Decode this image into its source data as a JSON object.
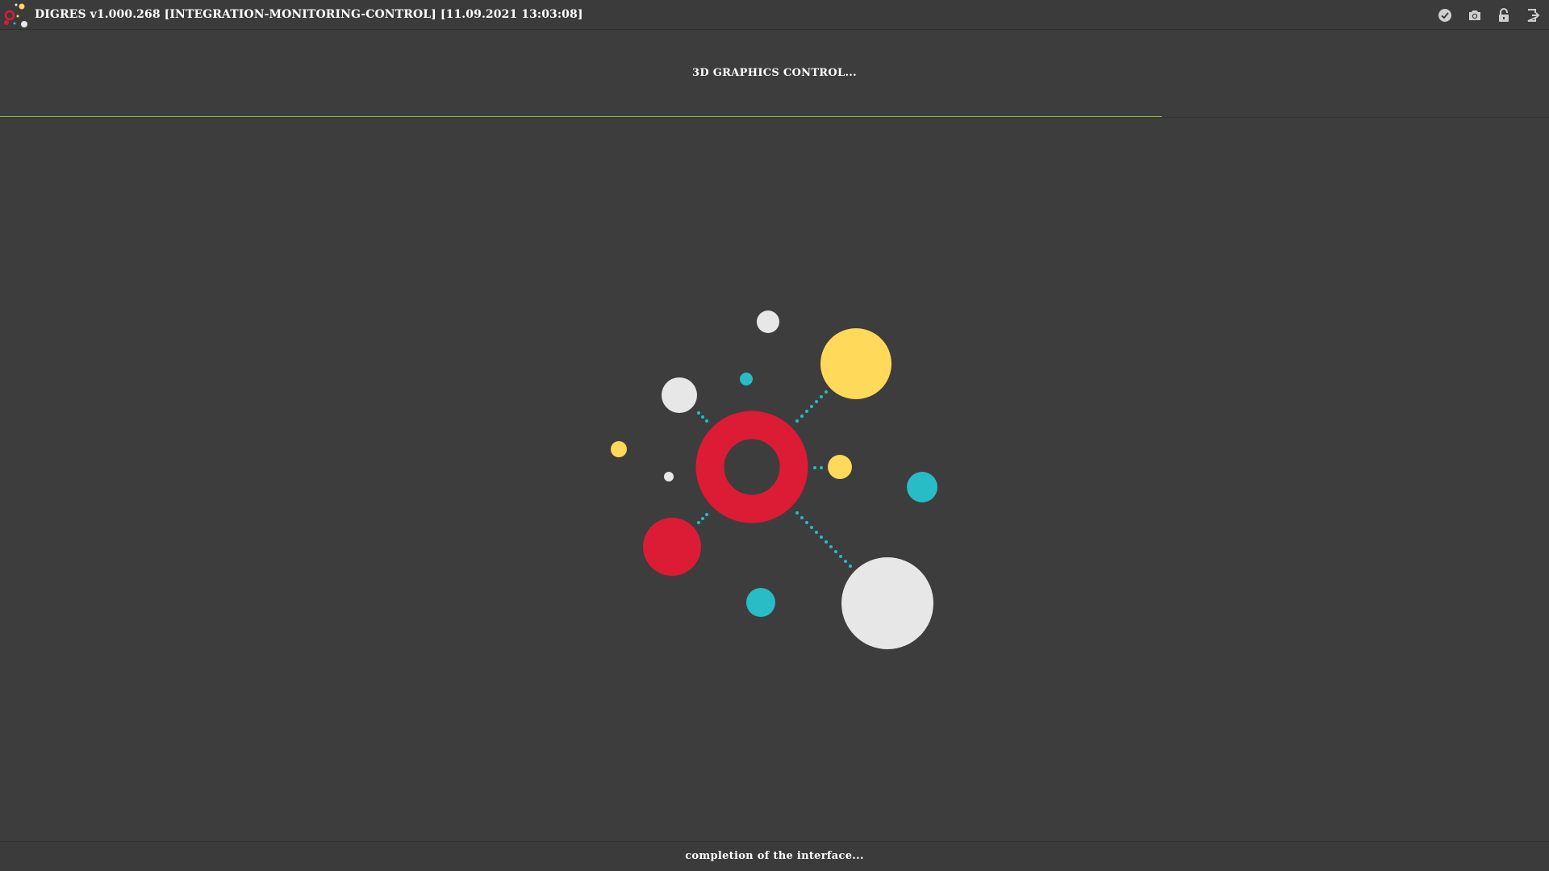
{
  "window": {
    "title": "DIGRES v1.000.268 [INTEGRATION-MONITORING-CONTROL] [11.09.2021 13:03:08]",
    "icons": [
      "check-circle-icon",
      "camera-icon",
      "lock-icon",
      "exit-icon"
    ]
  },
  "header": {
    "title": "3D GRAPHICS CONTROL...",
    "progress": 0.75
  },
  "status": {
    "text": "completion of the interface..."
  },
  "colors": {
    "background": "#3d3d3d",
    "accent_red": "#dc1b35",
    "accent_yellow": "#ffd95a",
    "accent_teal": "#28bcc6",
    "accent_white": "#e8e7e8",
    "progress_green": "#8fbf3a"
  }
}
